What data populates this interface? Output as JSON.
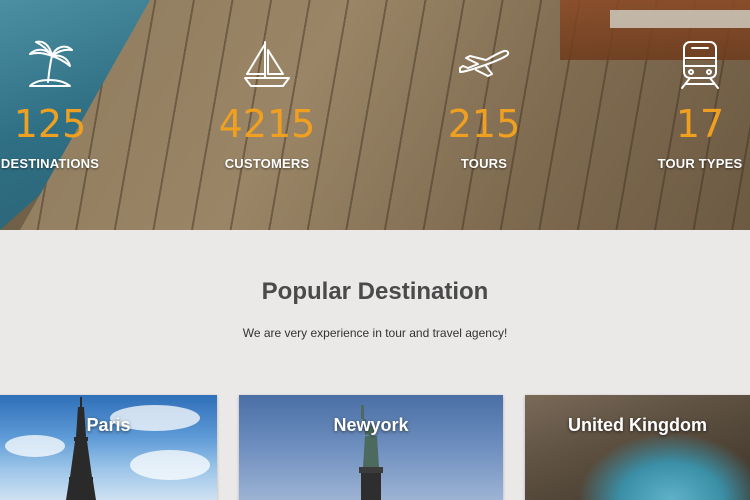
{
  "stats": [
    {
      "icon": "palm-island-icon",
      "number": "125",
      "label": "DESTINATIONS"
    },
    {
      "icon": "sailboat-icon",
      "number": "4215",
      "label": "CUSTOMERS"
    },
    {
      "icon": "airplane-icon",
      "number": "215",
      "label": "TOURS"
    },
    {
      "icon": "train-icon",
      "number": "17",
      "label": "TOUR TYPES"
    }
  ],
  "popular": {
    "title": "Popular Destination",
    "subtitle": "We are very experience in tour and travel agency!"
  },
  "destinations": [
    {
      "name": "Paris"
    },
    {
      "name": "Newyork"
    },
    {
      "name": "United Kingdom"
    }
  ],
  "colors": {
    "accent_number": "#f0a020",
    "section_background": "#ebe9e8",
    "title_text": "#4a4a4a"
  }
}
